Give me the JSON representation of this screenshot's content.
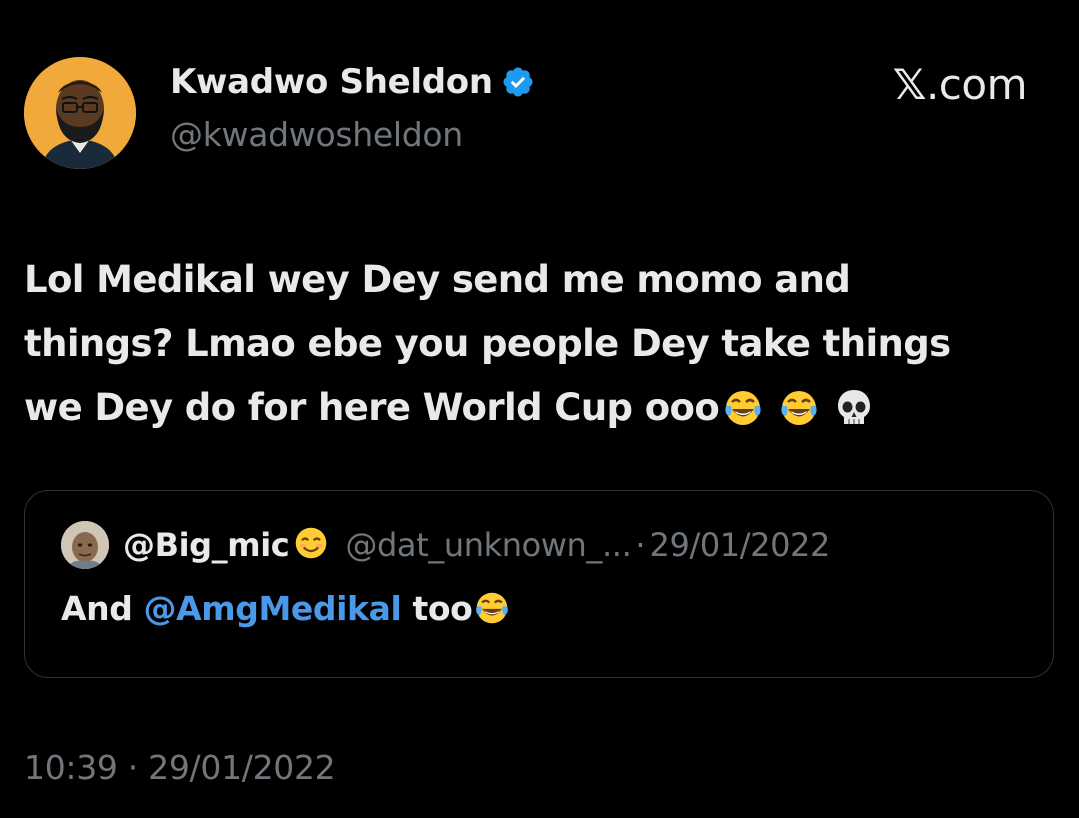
{
  "author": {
    "display_name": "Kwadwo Sheldon",
    "handle": "@kwadwosheldon",
    "verified": true,
    "avatar_icon": "bearded-man-avatar"
  },
  "site_label": {
    "mark": "𝕏",
    "suffix": ".com"
  },
  "tweet": {
    "line1": "Lol Medikal wey Dey send me momo and",
    "line2": "things? Lmao ebe you people Dey take things",
    "line3": "we Dey do for here World Cup ooo",
    "emojis": [
      "tears-of-joy-emoji",
      "tears-of-joy-emoji",
      "skull-emoji"
    ]
  },
  "quoted_tweet": {
    "display_name": "@Big_mic",
    "name_emoji": "smiling-face-emoji",
    "handle": "@dat_unknown_...",
    "separator": "·",
    "date": "29/01/2022",
    "body_prefix": "And ",
    "mention": "@AmgMedikal",
    "body_suffix": " too",
    "body_emoji": "tears-of-joy-emoji"
  },
  "timestamp": "10:39 · 29/01/2022",
  "colors": {
    "background": "#000000",
    "text_primary": "#e7e9ea",
    "text_secondary": "#71767b",
    "link": "#4a99e9",
    "verified_badge": "#1d9bf0",
    "card_border": "#2f3336",
    "avatar_bg": "#f2a93b"
  }
}
